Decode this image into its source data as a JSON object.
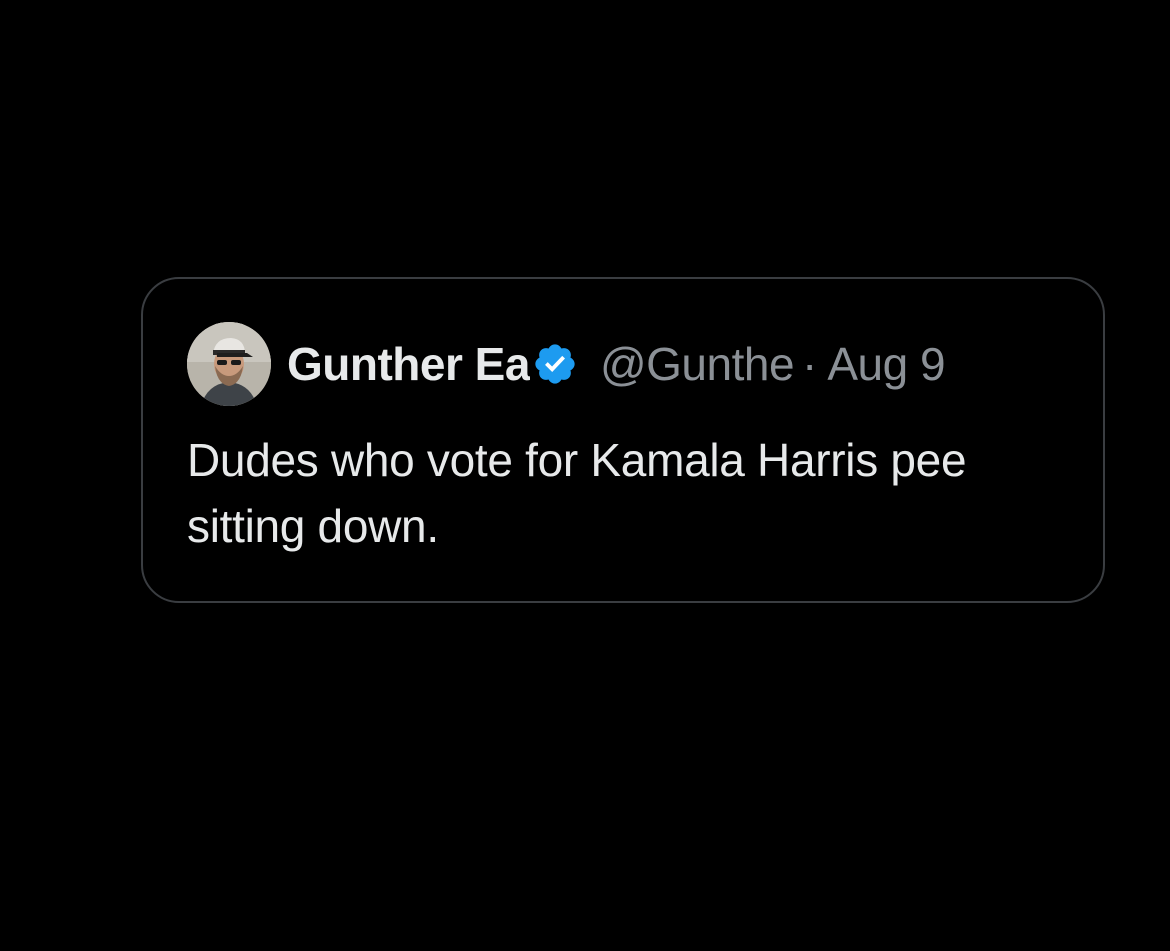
{
  "tweet": {
    "author": {
      "display_name": "Gunther Ea",
      "handle": "@Gunthe",
      "verified": true,
      "avatar": "user-photo"
    },
    "separator": "·",
    "date": "Aug 9",
    "text": "Dudes who vote for Kamala Harris pee sitting down."
  },
  "colors": {
    "background": "#000000",
    "card_border": "#3a3d41",
    "primary_text": "#e7e9ea",
    "secondary_text": "#8b9096",
    "verified_badge": "#1d9bf0"
  }
}
